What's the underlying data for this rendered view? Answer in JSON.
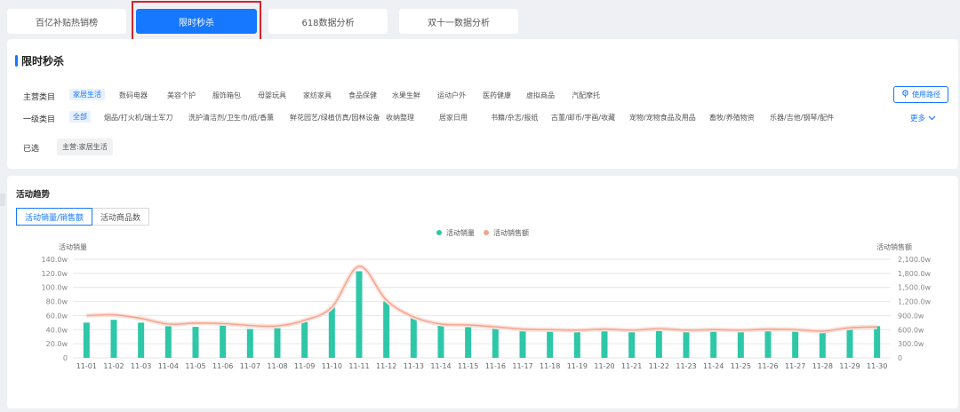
{
  "tabs": [
    {
      "label": "百亿补贴热销榜",
      "active": false
    },
    {
      "label": "限时秒杀",
      "active": true
    },
    {
      "label": "618数据分析",
      "active": false
    },
    {
      "label": "双十一数据分析",
      "active": false
    }
  ],
  "panel": {
    "title": "限时秒杀",
    "main_category_label": "主营类目",
    "main_categories": [
      "家居生活",
      "数码电器",
      "美容个护",
      "服饰箱包",
      "母婴玩具",
      "家纺家具",
      "食品保健",
      "水果生鲜",
      "运动户外",
      "医药健康",
      "虚拟商品",
      "汽配摩托"
    ],
    "level1_label": "一级类目",
    "level1_categories": [
      "全部",
      "烟品/打火机/瑞士军刀",
      "洗护清洁剂/卫生巾/纸/香薰",
      "鲜花园艺/绿植仿真/园林设备",
      "收纳整理",
      "居家日用",
      "书籍/杂志/报纸",
      "古董/邮币/字画/收藏",
      "宠物/宠物食品及用品",
      "畜牧/养殖物资",
      "乐器/吉他/钢琴/配件"
    ],
    "guide_button": "使用路径",
    "more": "更多",
    "selected_label": "已选",
    "selected_tag": "主营:家居生活"
  },
  "chart_panel": {
    "title": "活动趋势",
    "tabs": [
      "活动销量/销售额",
      "活动商品数"
    ],
    "active_tab": 0
  },
  "colors": {
    "accent": "#1677ff",
    "bar": "#2ec7a8",
    "line": "#f4a28c",
    "highlight": "#d9232d"
  },
  "chart_data": {
    "type": "bar",
    "ylabel_left": "活动销量",
    "ylabel_right": "活动销售额",
    "y_left_ticks": [
      "0",
      "20.0w",
      "40.0w",
      "60.0w",
      "80.0w",
      "100.0w",
      "120.0w",
      "140.0w"
    ],
    "y_right_ticks": [
      "0",
      "300.0w",
      "600.0w",
      "900.0w",
      "1,200.0w",
      "1,500.0w",
      "1,800.0w",
      "2,100.0w"
    ],
    "ylim_left": [
      0,
      140
    ],
    "ylim_right": [
      0,
      2100
    ],
    "legend_position": "top-center",
    "categories": [
      "11-01",
      "11-02",
      "11-03",
      "11-04",
      "11-05",
      "11-06",
      "11-07",
      "11-08",
      "11-09",
      "11-10",
      "11-11",
      "11-12",
      "11-13",
      "11-14",
      "11-15",
      "11-16",
      "11-17",
      "11-18",
      "11-19",
      "11-20",
      "11-21",
      "11-22",
      "11-23",
      "11-24",
      "11-25",
      "11-26",
      "11-27",
      "11-28",
      "11-29",
      "11-30"
    ],
    "series": [
      {
        "name": "活动销量",
        "type": "bar",
        "axis": "left",
        "values": [
          50,
          54,
          50,
          45,
          44,
          46,
          41,
          42,
          51,
          73,
          123,
          80,
          58,
          47,
          47,
          45,
          39,
          40,
          39,
          41,
          37,
          42,
          40,
          41,
          40,
          43,
          42,
          39,
          44,
          45
        ]
      },
      {
        "name": "活动销售额",
        "type": "line",
        "axis": "right",
        "values": [
          900,
          915,
          840,
          720,
          740,
          730,
          690,
          680,
          800,
          1080,
          1950,
          1230,
          870,
          720,
          700,
          660,
          610,
          600,
          590,
          610,
          590,
          620,
          590,
          600,
          590,
          610,
          600,
          570,
          640,
          660
        ]
      }
    ]
  }
}
